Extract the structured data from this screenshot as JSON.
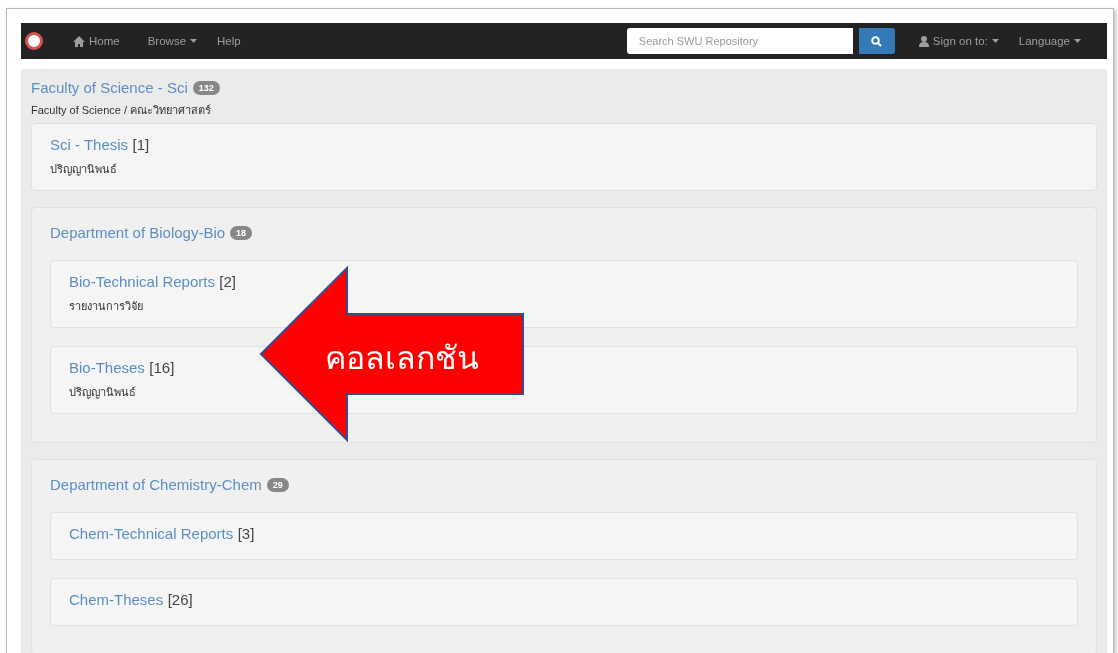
{
  "navbar": {
    "items": [
      {
        "label": "Home",
        "kind": "home"
      },
      {
        "label": "Browse",
        "kind": "dropdown"
      },
      {
        "label": "Help",
        "kind": "link"
      }
    ],
    "search": {
      "placeholder": "Search SWU Repository"
    },
    "right_items": [
      {
        "label": "Sign on to:",
        "kind": "user"
      },
      {
        "label": "Language",
        "kind": "dropdown"
      }
    ]
  },
  "community": {
    "title": "Faculty of Science - Sci",
    "count": "132",
    "description": "Faculty of Science / คณะวิทยาศาสตร์",
    "collections": [
      {
        "name": "Sci - Thesis",
        "count": "[1]",
        "description": "ปริญญานิพนธ์"
      }
    ],
    "subcommunities": [
      {
        "title": "Department of Biology-Bio",
        "count": "18",
        "collections": [
          {
            "name": "Bio-Technical Reports",
            "count": "[2]",
            "description": "รายงานการวิจัย"
          },
          {
            "name": "Bio-Theses",
            "count": "[16]",
            "description": "ปริญญานิพนธ์"
          }
        ]
      },
      {
        "title": "Department of Chemistry-Chem",
        "count": "29",
        "collections": [
          {
            "name": "Chem-Technical Reports",
            "count": "[3]"
          },
          {
            "name": "Chem-Theses",
            "count": "[26]"
          }
        ]
      }
    ]
  },
  "annotation": {
    "label": "คอลเลกชัน"
  }
}
